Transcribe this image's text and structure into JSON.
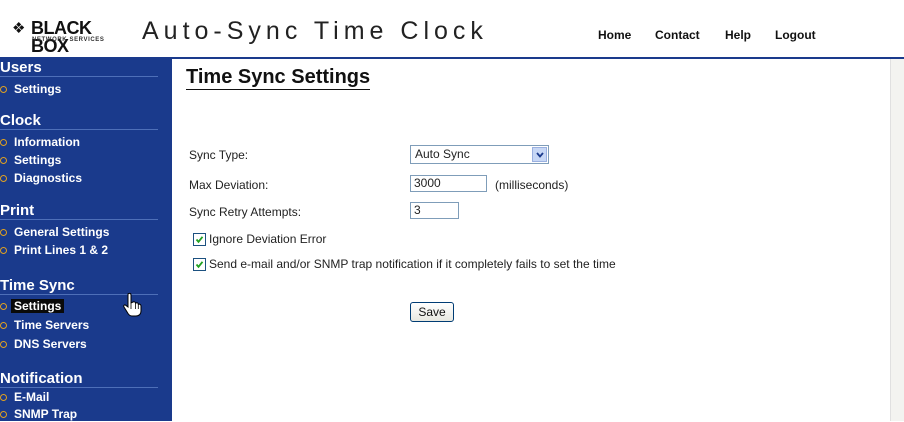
{
  "header": {
    "logo_text": "BLACK BOX",
    "logo_sub": "NETWORK SERVICES",
    "app_title": "Auto-Sync Time Clock",
    "nav": [
      {
        "label": "Home"
      },
      {
        "label": "Contact"
      },
      {
        "label": "Help"
      },
      {
        "label": "Logout"
      }
    ]
  },
  "sidebar": {
    "sections": [
      {
        "title": "Users",
        "items": [
          {
            "label": "Settings"
          }
        ]
      },
      {
        "title": "Clock",
        "items": [
          {
            "label": "Information"
          },
          {
            "label": "Settings"
          },
          {
            "label": "Diagnostics"
          }
        ]
      },
      {
        "title": "Print",
        "items": [
          {
            "label": "General Settings"
          },
          {
            "label": "Print Lines 1 & 2"
          }
        ]
      },
      {
        "title": "Time Sync",
        "items": [
          {
            "label": "Settings"
          },
          {
            "label": "Time Servers"
          },
          {
            "label": "DNS Servers"
          }
        ]
      },
      {
        "title": "Notification",
        "items": [
          {
            "label": "E-Mail"
          },
          {
            "label": "SNMP Trap"
          }
        ]
      }
    ],
    "active_item": "Time Sync > Settings"
  },
  "main": {
    "title": "Time Sync Settings",
    "fields": {
      "sync_type": {
        "label": "Sync Type:",
        "value": "Auto Sync"
      },
      "max_deviation": {
        "label": "Max Deviation:",
        "value": "3000",
        "unit": "(milliseconds)"
      },
      "retry_attempts": {
        "label": "Sync Retry Attempts:",
        "value": "3"
      }
    },
    "checkboxes": {
      "ignore_deviation": {
        "label": "Ignore Deviation Error",
        "checked": true
      },
      "send_notification": {
        "label": "Send e-mail and/or SNMP trap notification if it completely fails to set the time",
        "checked": true
      }
    },
    "save_label": "Save"
  },
  "colors": {
    "sidebar_bg": "#1a3a8c",
    "bullet": "#e0a020",
    "header_rule": "#1a3a8c"
  },
  "icons": {
    "logo": "black-box-diamond-icon",
    "dropdown": "chevron-down-icon",
    "checkbox": "check-icon",
    "pointer": "hand-pointer-icon"
  }
}
